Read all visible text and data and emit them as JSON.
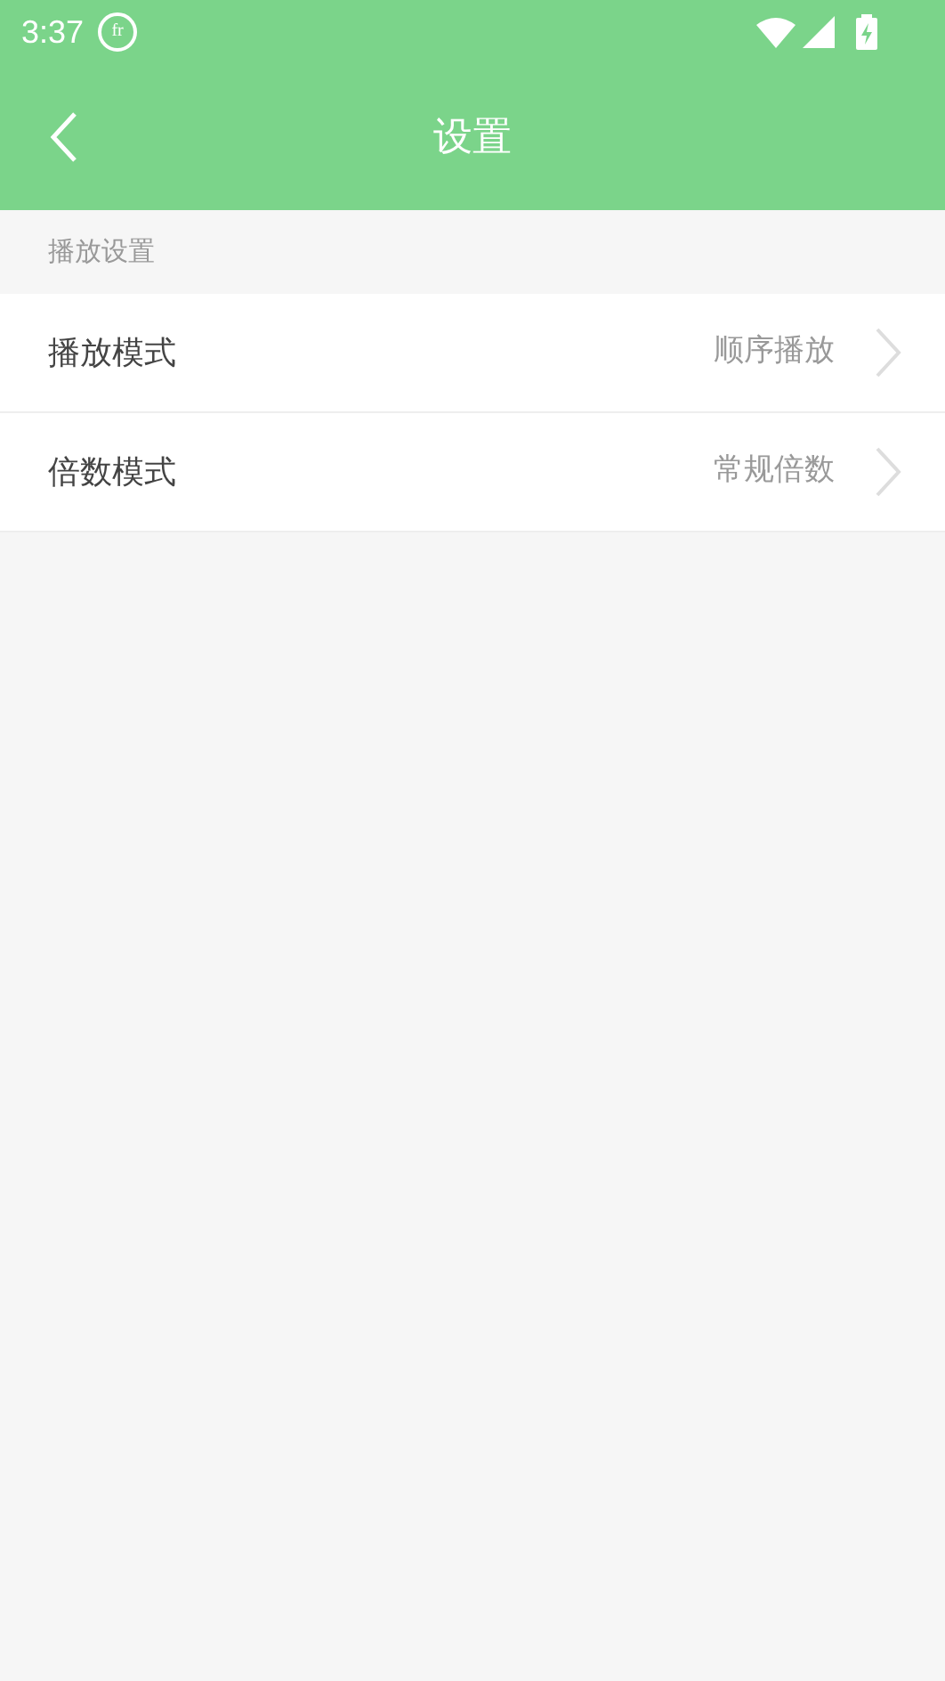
{
  "status_bar": {
    "time": "3:37",
    "notification_icon_text": "fr"
  },
  "toolbar": {
    "title": "设置"
  },
  "section": {
    "title": "播放设置"
  },
  "rows": [
    {
      "label": "播放模式",
      "value": "顺序播放"
    },
    {
      "label": "倍数模式",
      "value": "常规倍数"
    }
  ]
}
